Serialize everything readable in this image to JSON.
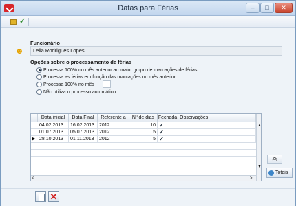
{
  "window": {
    "title": "Datas para Férias",
    "minimize_glyph": "–",
    "maximize_glyph": "□",
    "close_glyph": "✕"
  },
  "toolbar": {
    "icons": [
      "folder-icon",
      "tools-icon"
    ]
  },
  "employee": {
    "label": "Funcionário",
    "value": "Leila Rodrigues Lopes"
  },
  "options": {
    "label": "Opções sobre o processamento de férias",
    "items": [
      {
        "label": "Processa 100% no mês anterior ao maior grupo de marcações de férias",
        "selected": true
      },
      {
        "label": "Processa as férias em função das marcações no mês anterior",
        "selected": false
      },
      {
        "label": "Processa 100% no mês",
        "selected": false
      },
      {
        "label": "Não utiliza o processo automático",
        "selected": false
      }
    ],
    "months_value": ""
  },
  "grid": {
    "columns": [
      "Data inicial",
      "Data Final",
      "Referente a",
      "Nº de dias",
      "Fechada",
      "Observações"
    ],
    "rows": [
      {
        "start": "04.02.2013",
        "end": "16.02.2013",
        "ref": "2012",
        "days": "10",
        "closed": true,
        "notes": "",
        "current": false
      },
      {
        "start": "01.07.2013",
        "end": "05.07.2013",
        "ref": "2012",
        "days": "5",
        "closed": true,
        "notes": "",
        "current": false
      },
      {
        "start": "28.10.2013",
        "end": "01.11.2013",
        "ref": "2012",
        "days": "5",
        "closed": true,
        "notes": "",
        "current": true
      }
    ],
    "current_row_marker": "▶",
    "scroll_up": "▲",
    "scroll_down": "▼",
    "scroll_left": "<",
    "scroll_right": ">",
    "check_glyph": "✔"
  },
  "side_buttons": {
    "print_icon": "printer-icon",
    "totais_label": "Totais"
  },
  "bottom": {
    "new_icon": "new-document-icon",
    "delete_glyph": "✕"
  }
}
